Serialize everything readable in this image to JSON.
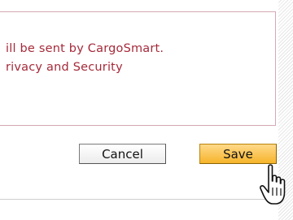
{
  "message": {
    "line1": "ill be sent by CargoSmart.",
    "line2": "rivacy and Security"
  },
  "actions": {
    "cancel_label": "Cancel",
    "save_label": "Save"
  },
  "cursor": {
    "icon": "hand-pointer-icon"
  },
  "colors": {
    "message_text": "#a52a3a",
    "save_button": "#f6b42a",
    "box_border": "#d5a9b3"
  }
}
